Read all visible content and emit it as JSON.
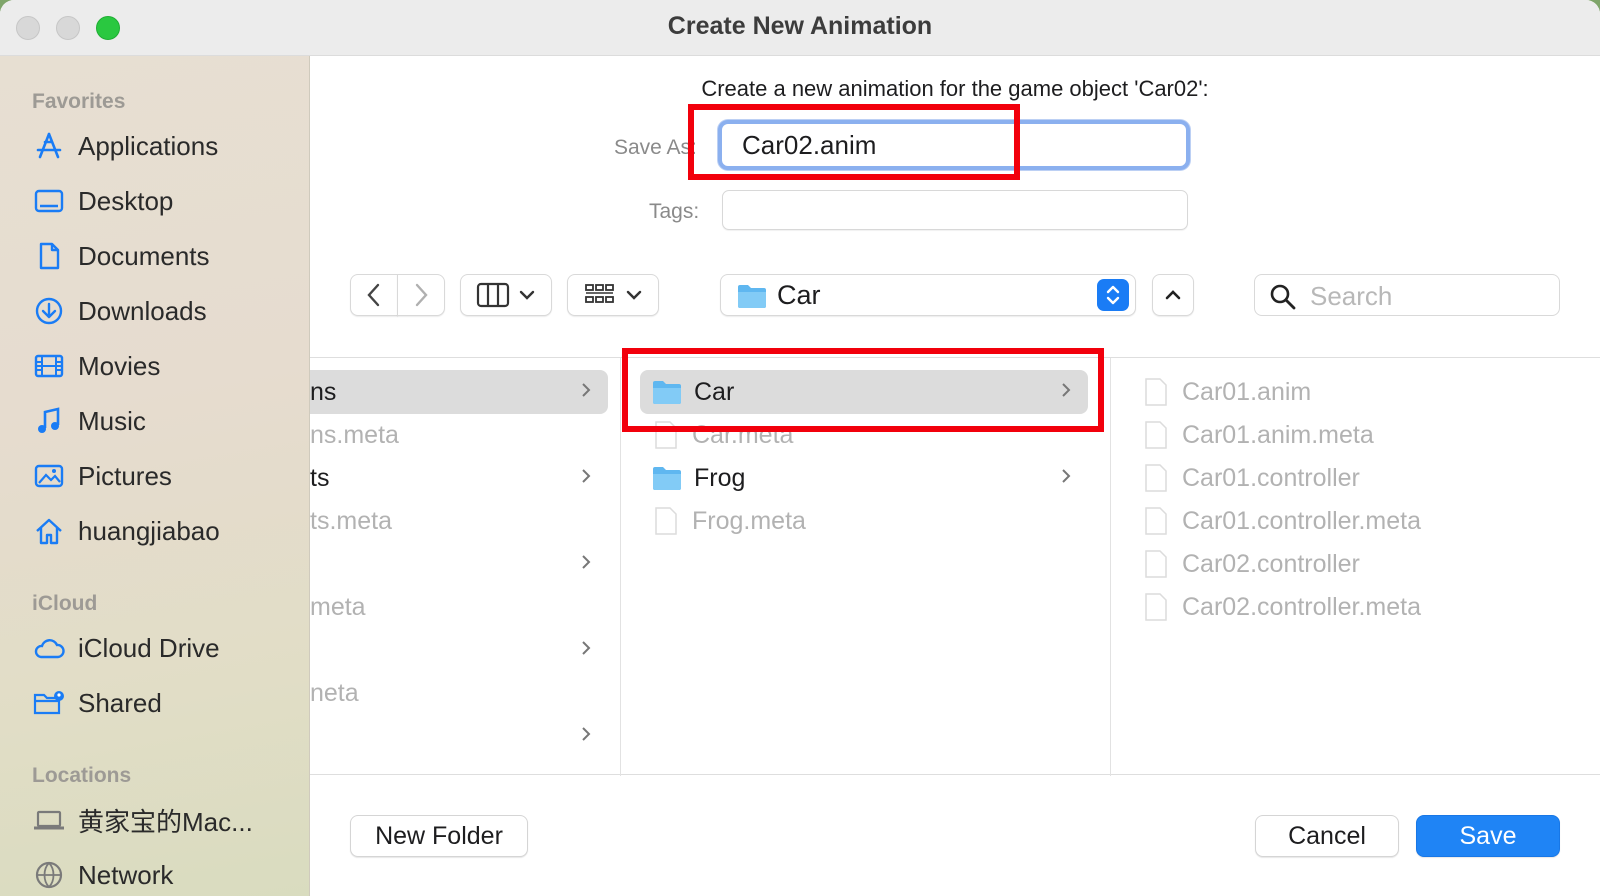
{
  "window": {
    "title": "Create New Animation"
  },
  "sidebar": {
    "favorites_title": "Favorites",
    "favorites": [
      {
        "label": "Applications",
        "icon": "applications-icon"
      },
      {
        "label": "Desktop",
        "icon": "desktop-icon"
      },
      {
        "label": "Documents",
        "icon": "document-icon"
      },
      {
        "label": "Downloads",
        "icon": "downloads-icon"
      },
      {
        "label": "Movies",
        "icon": "movies-icon"
      },
      {
        "label": "Music",
        "icon": "music-icon"
      },
      {
        "label": "Pictures",
        "icon": "pictures-icon"
      },
      {
        "label": "huangjiabao",
        "icon": "home-icon"
      }
    ],
    "icloud_title": "iCloud",
    "icloud": [
      {
        "label": "iCloud Drive",
        "icon": "cloud-icon"
      },
      {
        "label": "Shared",
        "icon": "shared-folder-icon"
      }
    ],
    "locations_title": "Locations",
    "locations": [
      {
        "label": "黄家宝的Mac...",
        "icon": "laptop-icon"
      },
      {
        "label": "Network",
        "icon": "network-icon"
      }
    ],
    "accent_color": "#1a7cf5"
  },
  "dialog": {
    "prompt": "Create a new animation for the game object 'Car02':",
    "save_as_label": "Save As:",
    "save_as_value": "Car02.anim",
    "tags_label": "Tags:",
    "tags_value": "",
    "current_folder": "Car",
    "search_placeholder": "Search"
  },
  "browser": {
    "column1": [
      {
        "label": "ns",
        "folder": true,
        "selected": true
      },
      {
        "label": "ns.meta",
        "folder": false
      },
      {
        "label": "ts",
        "folder": true
      },
      {
        "label": "ts.meta",
        "folder": false
      },
      {
        "label": "",
        "folder": true
      },
      {
        "label": "meta",
        "folder": false
      },
      {
        "label": "",
        "folder": true
      },
      {
        "label": "neta",
        "folder": false
      },
      {
        "label": "",
        "folder": true
      }
    ],
    "column2": [
      {
        "label": "Car",
        "folder": true,
        "selected": true
      },
      {
        "label": "Car.meta",
        "folder": false
      },
      {
        "label": "Frog",
        "folder": true
      },
      {
        "label": "Frog.meta",
        "folder": false
      }
    ],
    "column3": [
      {
        "label": "Car01.anim"
      },
      {
        "label": "Car01.anim.meta"
      },
      {
        "label": "Car01.controller"
      },
      {
        "label": "Car01.controller.meta"
      },
      {
        "label": "Car02.controller"
      },
      {
        "label": "Car02.controller.meta"
      }
    ]
  },
  "footer": {
    "new_folder_label": "New Folder",
    "cancel_label": "Cancel",
    "save_label": "Save"
  },
  "colors": {
    "annotation": "#f2000c",
    "primary_button": "#1f84f5",
    "focus_ring": "#8bb0ef"
  }
}
